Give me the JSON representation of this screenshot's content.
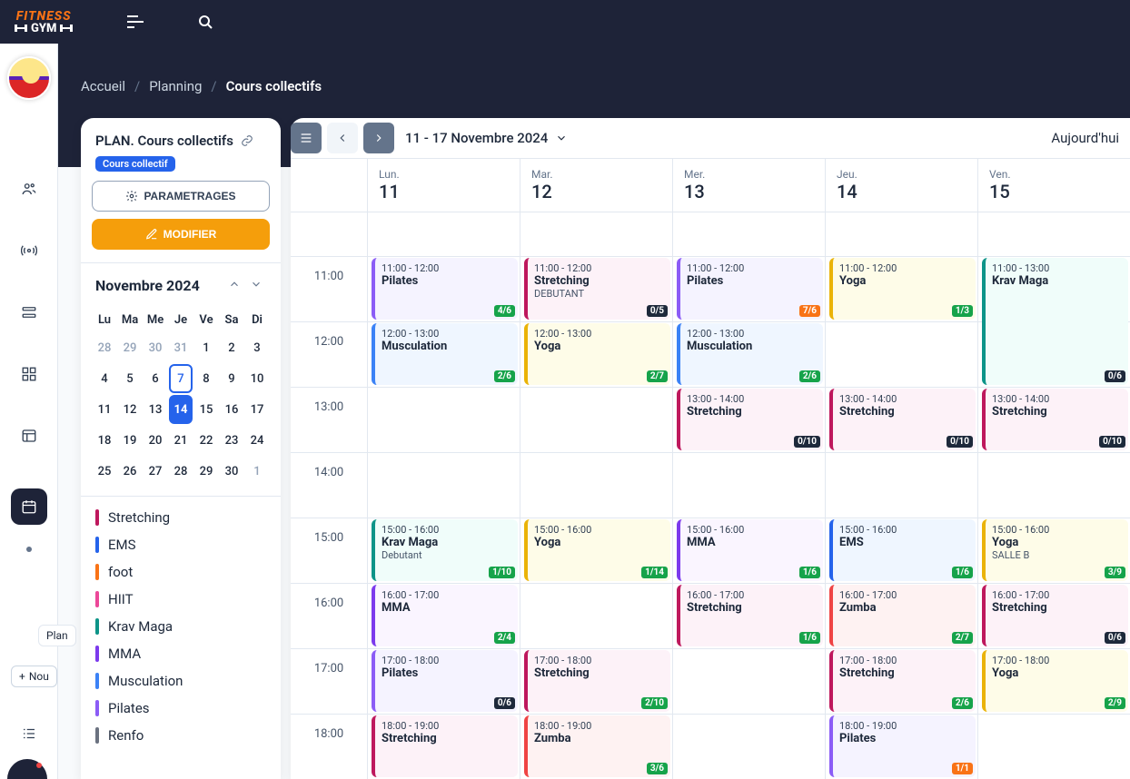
{
  "logo": {
    "top": "FITNESS",
    "bot": "GYM"
  },
  "breadcrumb": {
    "items": [
      "Accueil",
      "Planning"
    ],
    "current": "Cours collectifs"
  },
  "sidebar": {
    "title": "PLAN. Cours collectifs",
    "badge": "Cours collectif",
    "btn_params": "PARAMETRAGES",
    "btn_modify": "MODIFIER",
    "rail_tip": "Plan",
    "rail_nouv": "Nou"
  },
  "minical": {
    "month": "Novembre 2024",
    "dow": [
      "Lu",
      "Ma",
      "Me",
      "Je",
      "Ve",
      "Sa",
      "Di"
    ],
    "weeks": [
      [
        {
          "d": 28,
          "o": 1
        },
        {
          "d": 29,
          "o": 1
        },
        {
          "d": 30,
          "o": 1
        },
        {
          "d": 31,
          "o": 1
        },
        {
          "d": 1
        },
        {
          "d": 2
        },
        {
          "d": 3
        }
      ],
      [
        {
          "d": 4
        },
        {
          "d": 5
        },
        {
          "d": 6
        },
        {
          "d": 7,
          "today": 1
        },
        {
          "d": 8
        },
        {
          "d": 9
        },
        {
          "d": 10
        }
      ],
      [
        {
          "d": 11
        },
        {
          "d": 12
        },
        {
          "d": 13
        },
        {
          "d": 14,
          "sel": 1
        },
        {
          "d": 15
        },
        {
          "d": 16
        },
        {
          "d": 17
        }
      ],
      [
        {
          "d": 18
        },
        {
          "d": 19
        },
        {
          "d": 20
        },
        {
          "d": 21
        },
        {
          "d": 22
        },
        {
          "d": 23
        },
        {
          "d": 24
        }
      ],
      [
        {
          "d": 25
        },
        {
          "d": 26
        },
        {
          "d": 27
        },
        {
          "d": 28
        },
        {
          "d": 29
        },
        {
          "d": 30
        },
        {
          "d": 1,
          "o": 1
        }
      ]
    ]
  },
  "categories": [
    {
      "name": "Stretching",
      "color": "#be185d"
    },
    {
      "name": "EMS",
      "color": "#2563eb"
    },
    {
      "name": "foot",
      "color": "#f97316"
    },
    {
      "name": "HIIT",
      "color": "#ec4899"
    },
    {
      "name": "Krav Maga",
      "color": "#0d9488"
    },
    {
      "name": "MMA",
      "color": "#7c3aed"
    },
    {
      "name": "Musculation",
      "color": "#3b82f6"
    },
    {
      "name": "Pilates",
      "color": "#8b5cf6"
    },
    {
      "name": "Renfo",
      "color": "#6b7280"
    }
  ],
  "toolbar": {
    "range": "11 - 17 Novembre 2024",
    "today": "Aujourd'hui"
  },
  "days": [
    {
      "dow": "Lun.",
      "date": "11"
    },
    {
      "dow": "Mar.",
      "date": "12"
    },
    {
      "dow": "Mer.",
      "date": "13"
    },
    {
      "dow": "Jeu.",
      "date": "14"
    },
    {
      "dow": "Ven.",
      "date": "15"
    }
  ],
  "hours": [
    "",
    "11:00",
    "12:00",
    "13:00",
    "14:00",
    "15:00",
    "16:00",
    "17:00",
    "18:00"
  ],
  "hourBase": 10,
  "colors": {
    "Pilates": {
      "border": "#8b5cf6",
      "bg": "#f5f3ff"
    },
    "Stretching": {
      "border": "#be185d",
      "bg": "#fdf2f8"
    },
    "Yoga": {
      "border": "#eab308",
      "bg": "#fefce8"
    },
    "Musculation": {
      "border": "#3b82f6",
      "bg": "#eff6ff"
    },
    "Krav Maga": {
      "border": "#0d9488",
      "bg": "#f0fdfa"
    },
    "MMA": {
      "border": "#7c3aed",
      "bg": "#faf5ff"
    },
    "EMS": {
      "border": "#2563eb",
      "bg": "#eff6ff"
    },
    "Zumba": {
      "border": "#ef4444",
      "bg": "#fef2f2"
    }
  },
  "events": [
    {
      "day": 0,
      "start": 11,
      "end": 12,
      "title": "Pilates",
      "badge": "4/6",
      "bc": "#16a34a"
    },
    {
      "day": 0,
      "start": 12,
      "end": 13,
      "title": "Musculation",
      "badge": "2/6",
      "bc": "#16a34a"
    },
    {
      "day": 0,
      "start": 15,
      "end": 16,
      "title": "Krav Maga",
      "sub": "Debutant",
      "badge": "1/10",
      "bc": "#16a34a"
    },
    {
      "day": 0,
      "start": 16,
      "end": 17,
      "title": "MMA",
      "badge": "2/4",
      "bc": "#16a34a"
    },
    {
      "day": 0,
      "start": 17,
      "end": 18,
      "title": "Pilates",
      "badge": "0/6",
      "bc": "#1e293b"
    },
    {
      "day": 0,
      "start": 18,
      "end": 19,
      "title": "Stretching"
    },
    {
      "day": 1,
      "start": 11,
      "end": 12,
      "title": "Stretching",
      "sub": "DEBUTANT",
      "badge": "0/5",
      "bc": "#1e293b"
    },
    {
      "day": 1,
      "start": 12,
      "end": 13,
      "title": "Yoga",
      "badge": "2/7",
      "bc": "#16a34a"
    },
    {
      "day": 1,
      "start": 15,
      "end": 16,
      "title": "Yoga",
      "badge": "1/14",
      "bc": "#16a34a"
    },
    {
      "day": 1,
      "start": 17,
      "end": 18,
      "title": "Stretching",
      "badge": "2/10",
      "bc": "#16a34a"
    },
    {
      "day": 1,
      "start": 18,
      "end": 19,
      "title": "Zumba",
      "badge": "3/6",
      "bc": "#16a34a"
    },
    {
      "day": 2,
      "start": 11,
      "end": 12,
      "title": "Pilates",
      "badge": "7/6",
      "bc": "#f97316"
    },
    {
      "day": 2,
      "start": 12,
      "end": 13,
      "title": "Musculation",
      "badge": "2/6",
      "bc": "#16a34a"
    },
    {
      "day": 2,
      "start": 13,
      "end": 14,
      "title": "Stretching",
      "badge": "0/10",
      "bc": "#1e293b"
    },
    {
      "day": 2,
      "start": 15,
      "end": 16,
      "title": "MMA",
      "badge": "1/6",
      "bc": "#16a34a"
    },
    {
      "day": 2,
      "start": 16,
      "end": 17,
      "title": "Stretching",
      "badge": "1/6",
      "bc": "#16a34a"
    },
    {
      "day": 3,
      "start": 11,
      "end": 12,
      "title": "Yoga",
      "badge": "1/3",
      "bc": "#16a34a"
    },
    {
      "day": 3,
      "start": 13,
      "end": 14,
      "title": "Stretching",
      "badge": "0/10",
      "bc": "#1e293b"
    },
    {
      "day": 3,
      "start": 15,
      "end": 16,
      "title": "EMS",
      "badge": "1/6",
      "bc": "#16a34a"
    },
    {
      "day": 3,
      "start": 16,
      "end": 17,
      "title": "Zumba",
      "badge": "2/7",
      "bc": "#16a34a"
    },
    {
      "day": 3,
      "start": 17,
      "end": 18,
      "title": "Stretching",
      "badge": "2/6",
      "bc": "#16a34a"
    },
    {
      "day": 3,
      "start": 18,
      "end": 19,
      "title": "Pilates",
      "badge": "1/1",
      "bc": "#f97316"
    },
    {
      "day": 4,
      "start": 11,
      "end": 13,
      "title": "Krav Maga",
      "badge": "0/6",
      "bc": "#1e293b"
    },
    {
      "day": 4,
      "start": 13,
      "end": 14,
      "title": "Stretching",
      "badge": "0/10",
      "bc": "#1e293b"
    },
    {
      "day": 4,
      "start": 15,
      "end": 16,
      "title": "Yoga",
      "sub": "SALLE B",
      "badge": "3/9",
      "bc": "#16a34a"
    },
    {
      "day": 4,
      "start": 16,
      "end": 17,
      "title": "Stretching",
      "badge": "0/6",
      "bc": "#1e293b"
    },
    {
      "day": 4,
      "start": 17,
      "end": 18,
      "title": "Yoga",
      "badge": "2/9",
      "bc": "#16a34a"
    }
  ]
}
